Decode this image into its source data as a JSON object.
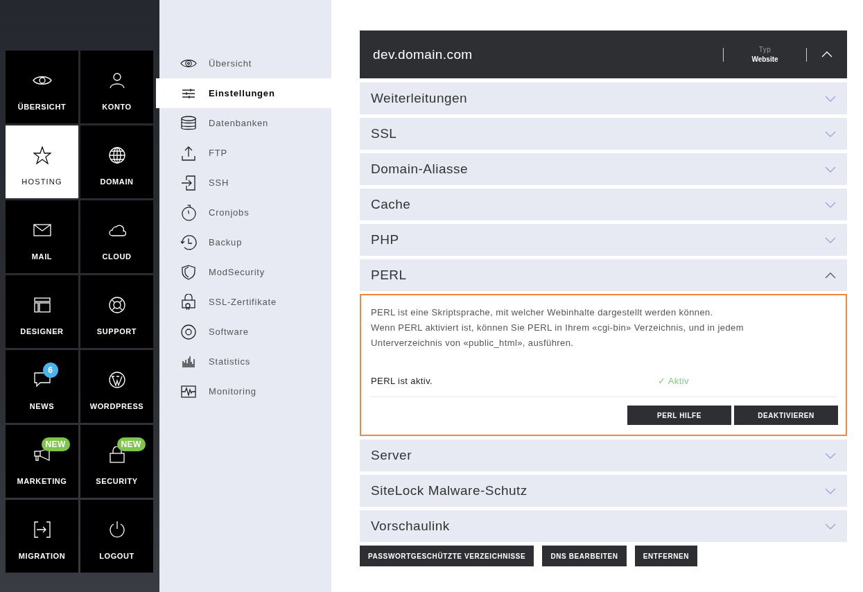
{
  "tiles": [
    {
      "label": "ÜBERSICHT",
      "selected": false
    },
    {
      "label": "KONTO",
      "selected": false
    },
    {
      "label": "HOSTING",
      "selected": true
    },
    {
      "label": "DOMAIN",
      "selected": false
    },
    {
      "label": "MAIL",
      "selected": false
    },
    {
      "label": "CLOUD",
      "selected": false
    },
    {
      "label": "DESIGNER",
      "selected": false
    },
    {
      "label": "SUPPORT",
      "selected": false
    },
    {
      "label": "NEWS",
      "selected": false,
      "badge": {
        "kind": "count",
        "text": "6"
      }
    },
    {
      "label": "WORDPRESS",
      "selected": false
    },
    {
      "label": "MARKETING",
      "selected": false,
      "badge": {
        "kind": "new",
        "text": "NEW"
      }
    },
    {
      "label": "SECURITY",
      "selected": false,
      "badge": {
        "kind": "new",
        "text": "NEW"
      }
    },
    {
      "label": "MIGRATION",
      "selected": false
    },
    {
      "label": "LOGOUT",
      "selected": false
    }
  ],
  "submenu": [
    {
      "label": "Übersicht",
      "selected": false
    },
    {
      "label": "Einstellungen",
      "selected": true
    },
    {
      "label": "Datenbanken",
      "selected": false
    },
    {
      "label": "FTP",
      "selected": false
    },
    {
      "label": "SSH",
      "selected": false
    },
    {
      "label": "Cronjobs",
      "selected": false
    },
    {
      "label": "Backup",
      "selected": false
    },
    {
      "label": "ModSecurity",
      "selected": false
    },
    {
      "label": "SSL-Zertifikate",
      "selected": false
    },
    {
      "label": "Software",
      "selected": false
    },
    {
      "label": "Statistics",
      "selected": false
    },
    {
      "label": "Monitoring",
      "selected": false
    }
  ],
  "domain_header": {
    "title": "dev.domain.com",
    "type_label": "Typ",
    "type_value": "Website",
    "expanded": true
  },
  "sections": [
    {
      "title": "Weiterleitungen",
      "expanded": false
    },
    {
      "title": "SSL",
      "expanded": false
    },
    {
      "title": "Domain-Aliasse",
      "expanded": false
    },
    {
      "title": "Cache",
      "expanded": false
    },
    {
      "title": "PHP",
      "expanded": false
    },
    {
      "title": "PERL",
      "expanded": true,
      "panel": {
        "description_lines": [
          "PERL ist eine Skriptsprache, mit welcher Webinhalte dargestellt werden können.",
          "Wenn PERL aktiviert ist, können Sie PERL in Ihrem «cgi-bin» Verzeichnis, und in jedem",
          "Unterverzeichnis von «public_html», ausführen."
        ],
        "status_label": "PERL ist aktiv.",
        "status_text": "✓ Aktiv",
        "active": true,
        "buttons": [
          "PERL HILFE",
          "DEAKTIVIEREN"
        ]
      }
    },
    {
      "title": "Server",
      "expanded": false
    },
    {
      "title": "SiteLock Malware-Schutz",
      "expanded": false
    },
    {
      "title": "Vorschaulink",
      "expanded": false
    }
  ],
  "bottom_buttons": [
    "PASSWORTGESCHÜTZTE VERZEICHNISSE",
    "DNS BEARBEITEN",
    "ENTFERNEN"
  ]
}
